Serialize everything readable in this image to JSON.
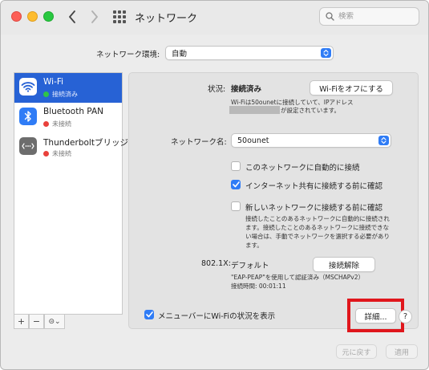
{
  "window": {
    "title": "ネットワーク",
    "search_placeholder": "検索"
  },
  "location": {
    "label": "ネットワーク環境:",
    "value": "自動"
  },
  "sidebar": {
    "items": [
      {
        "name": "Wi-Fi",
        "status": "接続済み",
        "status_color": "#2fc348",
        "icon": "wifi-icon"
      },
      {
        "name": "Bluetooth PAN",
        "status": "未接続",
        "status_color": "#e9413b",
        "icon": "bluetooth-icon"
      },
      {
        "name": "Thunderboltブリッジ",
        "status": "未接続",
        "status_color": "#e9413b",
        "icon": "thunderbolt-bridge-icon"
      }
    ],
    "add_label": "+",
    "remove_label": "−",
    "action_label": "⊝⌄"
  },
  "detail": {
    "status_label": "状況:",
    "status_value": "接続済み",
    "wifi_off_button": "Wi-Fiをオフにする",
    "status_desc_line1": "Wi-Fiは50ounetに接続していて、IPアドレス",
    "status_desc_line2": "が設定されています。",
    "network_name_label": "ネットワーク名:",
    "network_name_value": "50ounet",
    "options": [
      {
        "label": "このネットワークに自動的に接続",
        "checked": false
      },
      {
        "label": "インターネット共有に接続する前に確認",
        "checked": true
      },
      {
        "label": "新しいネットワークに接続する前に確認",
        "checked": false
      }
    ],
    "info_line1": "接続したことのあるネットワークに自動的に接続され",
    "info_line2": "ます。接続したことのあるネットワークに接続できな",
    "info_line3": "い場合は、手動でネットワークを選択する必要があり",
    "info_line4": "ます。",
    "x8021_label": "802.1X:",
    "x8021_value": "デフォルト",
    "disconnect_button": "接続解除",
    "eap_line1": "\"EAP-PEAP\"を使用して認証済み（MSCHAPv2）",
    "eap_line2": "接続時間: 00:01:11",
    "show_menubar_label": "メニューバーにWi-Fiの状況を表示",
    "show_menubar_checked": true,
    "advanced_button": "詳細...",
    "help_label": "?"
  },
  "footer": {
    "revert_button": "元に戻す",
    "apply_button": "適用"
  },
  "colors": {
    "accent": "#2f7cf6",
    "selection": "#2762d5",
    "highlight_box": "#e0161c"
  }
}
